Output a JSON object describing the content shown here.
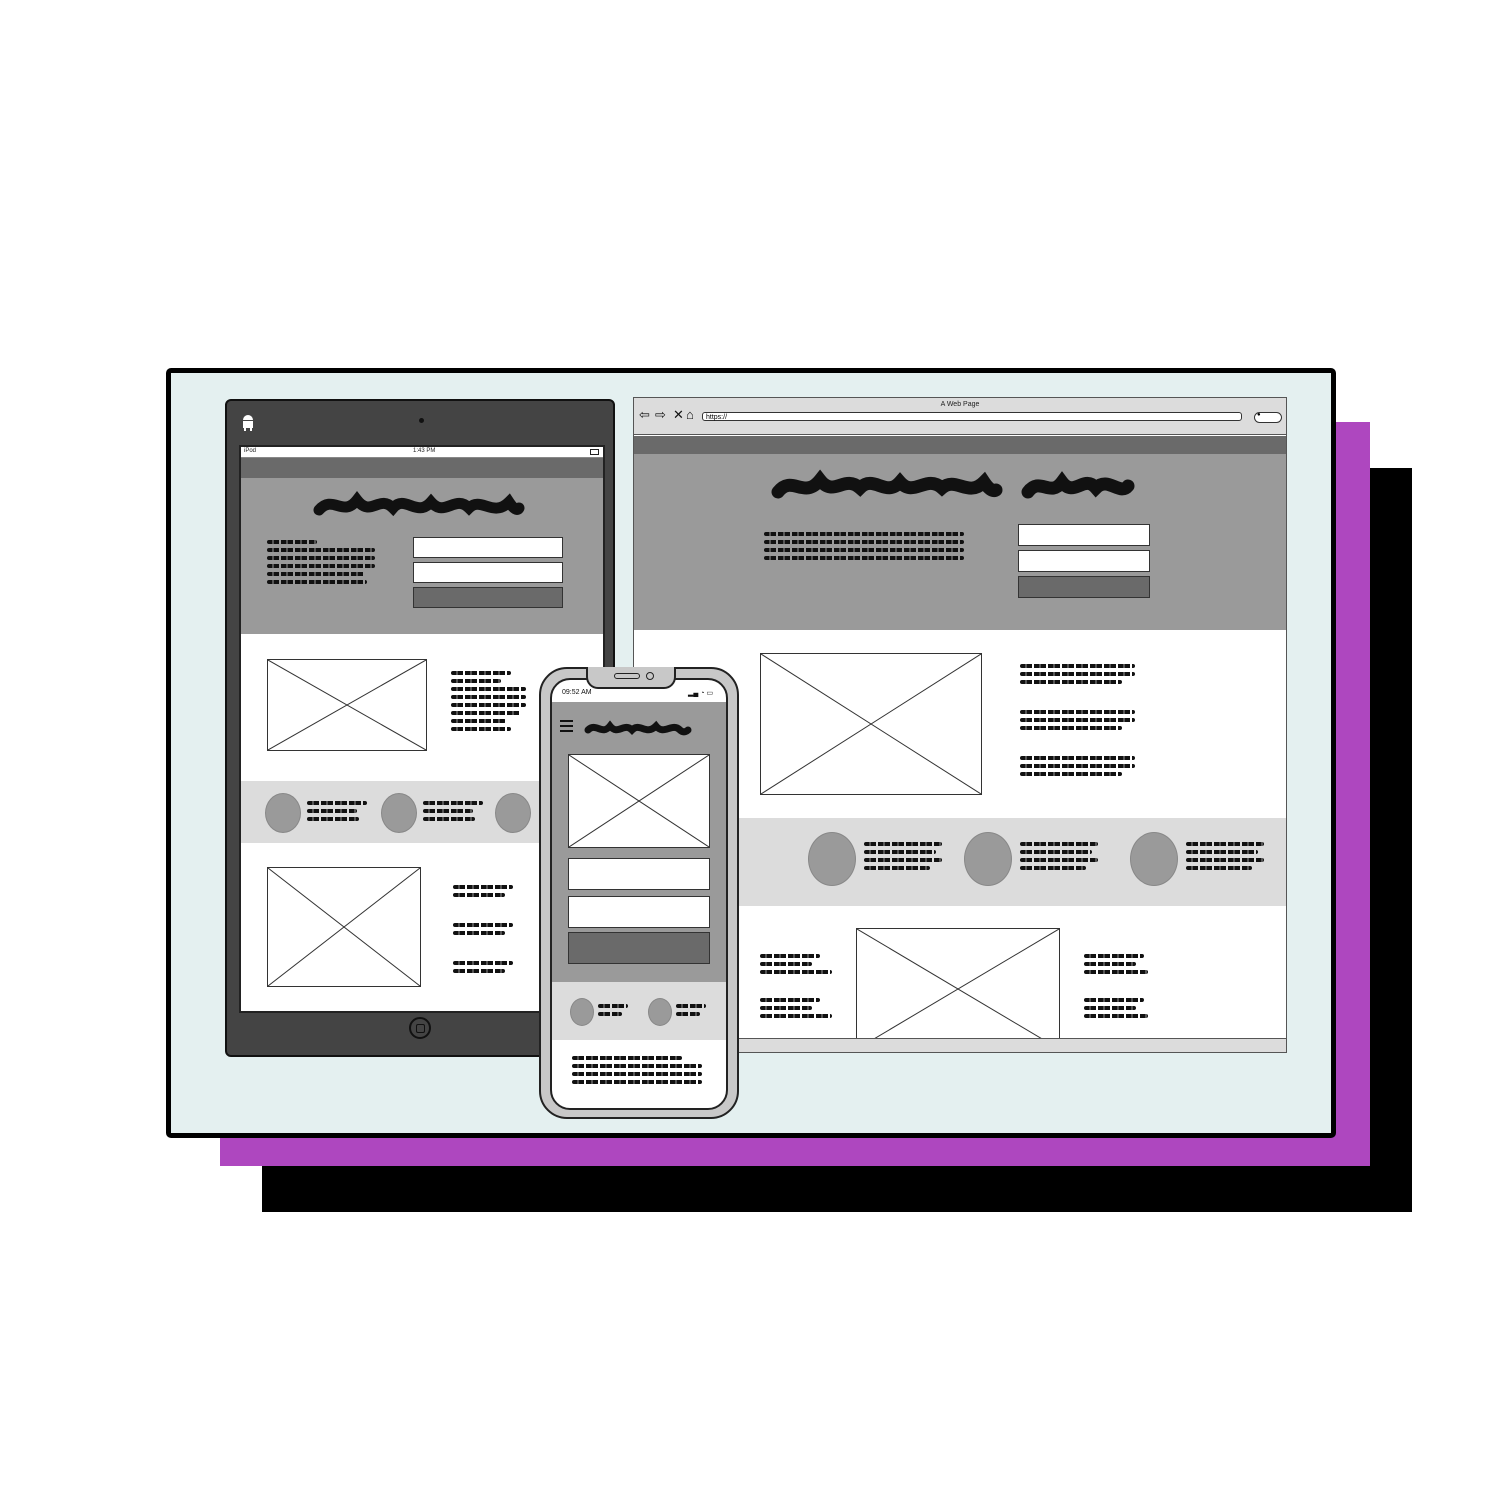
{
  "tablet": {
    "status_left": "iPod",
    "status_center": "1:43 PM",
    "os_icon": "android-icon",
    "home_icon": "home-button-icon"
  },
  "browser": {
    "title": "A Web Page",
    "url": "https://",
    "nav_icons": [
      "back-icon",
      "forward-icon",
      "close-icon",
      "home-icon"
    ],
    "search_icon": "search-icon"
  },
  "phone": {
    "time": "09:52 AM",
    "menu_icon": "hamburger-menu-icon"
  },
  "colors": {
    "purple_shadow": "#ae47bf",
    "frame_bg": "#e4f0f0",
    "dark_gray": "#6a6a6a",
    "mid_gray": "#9a9a9a",
    "light_gray": "#dcdcdc"
  }
}
